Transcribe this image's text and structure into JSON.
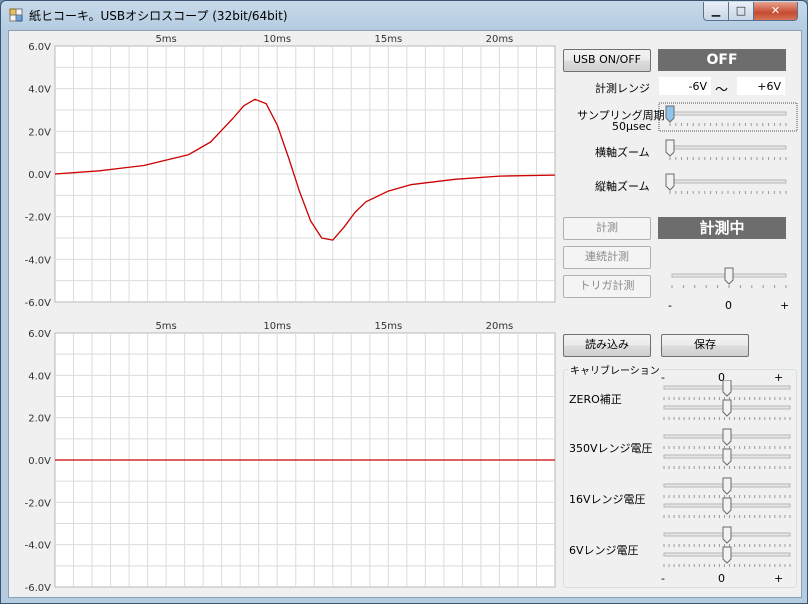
{
  "window": {
    "title": "紙ヒコーキ。USBオシロスコープ (32bit/64bit)"
  },
  "plot_top": {
    "y_ticks": [
      "6.0V",
      "4.0V",
      "2.0V",
      "0.0V",
      "-2.0V",
      "-4.0V",
      "-6.0V"
    ],
    "x_ticks": [
      "5ms",
      "10ms",
      "15ms",
      "20ms"
    ],
    "trace_color": "#cc0000"
  },
  "plot_bottom": {
    "y_ticks": [
      "6.0V",
      "4.0V",
      "2.0V",
      "0.0V",
      "-2.0V",
      "-4.0V",
      "-6.0V"
    ],
    "x_ticks": [
      "5ms",
      "10ms",
      "15ms",
      "20ms"
    ],
    "trace_color": "#cc0000"
  },
  "chart_data": [
    {
      "type": "line",
      "xlabel": "",
      "ylabel": "",
      "ylim": [
        -6,
        6
      ],
      "xlim": [
        0,
        22.5
      ],
      "x_ticks": [
        5,
        10,
        15,
        20
      ],
      "grid": true,
      "series": [
        {
          "x": [
            0,
            2,
            4,
            6,
            7,
            8,
            8.5,
            9,
            9.5,
            10,
            10.5,
            11,
            11.5,
            12,
            12.5,
            13,
            13.5,
            14,
            15,
            16,
            18,
            20,
            22.5
          ],
          "y": [
            0,
            0.15,
            0.4,
            0.9,
            1.5,
            2.6,
            3.2,
            3.5,
            3.3,
            2.3,
            0.8,
            -0.8,
            -2.2,
            -3.0,
            -3.1,
            -2.5,
            -1.8,
            -1.3,
            -0.8,
            -0.5,
            -0.25,
            -0.1,
            -0.05
          ]
        }
      ]
    },
    {
      "type": "line",
      "xlabel": "",
      "ylabel": "",
      "ylim": [
        -6,
        6
      ],
      "xlim": [
        0,
        22.5
      ],
      "x_ticks": [
        5,
        10,
        15,
        20
      ],
      "grid": true,
      "series": [
        {
          "x": [
            0,
            22.5
          ],
          "y": [
            0,
            0
          ]
        }
      ]
    }
  ],
  "controls": {
    "usb_button": "USB ON/OFF",
    "usb_status": "OFF",
    "range_label": "計測レンジ",
    "range_min": "-6V",
    "range_sep": "～",
    "range_max": "+6V",
    "sampling_label_1": "サンプリング周期",
    "sampling_label_2": "50μsec",
    "sampling_value": 0,
    "hzoom_label": "横軸ズーム",
    "hzoom_value": 0,
    "vzoom_label": "縦軸ズーム",
    "vzoom_value": 0,
    "measure_button": "計測",
    "measure_status": "計測中",
    "continuous_button": "連続計測",
    "trigger_button": "トリガ計測",
    "trigger_minus": "-",
    "trigger_zero": "0",
    "trigger_plus": "+",
    "trigger_value": 0.5,
    "load_button": "読み込み",
    "save_button": "保存",
    "calibration_title": "キャリブレーション",
    "cal_minus": "-",
    "cal_zero": "0",
    "cal_plus": "+",
    "cal_zero_label": "ZERO補正",
    "cal_350_label": "350Vレンジ電圧",
    "cal_16_label": "16Vレンジ電圧",
    "cal_6_label": "6Vレンジ電圧",
    "cal_values": [
      0.5,
      0.5,
      0.5,
      0.5,
      0.5,
      0.5,
      0.5,
      0.5
    ]
  },
  "colors": {
    "status_bg": "#6d6d6d",
    "trace": "#cc0000"
  }
}
